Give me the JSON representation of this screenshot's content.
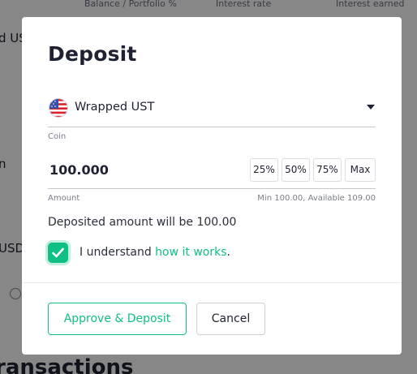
{
  "background": {
    "columns": [
      "Balance / Portfolio %",
      "Interest rate",
      "Interest earned"
    ],
    "fragments": [
      "d UST",
      "n",
      "USD"
    ],
    "section_title": "ransactions"
  },
  "modal": {
    "title": "Deposit",
    "coin": {
      "selected": "Wrapped UST",
      "icon": "us-flag-icon",
      "label": "Coin"
    },
    "amount": {
      "value": "100.000",
      "label": "Amount",
      "limits": "Min 100.00, Available 109.00",
      "presets": [
        "25%",
        "50%",
        "75%",
        "Max"
      ]
    },
    "deposit_note": "Deposited amount will be 100.00",
    "understand": {
      "prefix": "I understand ",
      "link": "how it works",
      "suffix": ".",
      "checked": true
    },
    "buttons": {
      "primary": "Approve & Deposit",
      "secondary": "Cancel"
    }
  },
  "colors": {
    "accent": "#0fbf86",
    "text": "#1f2233",
    "overlay": "rgba(0,0,0,0.47)"
  }
}
